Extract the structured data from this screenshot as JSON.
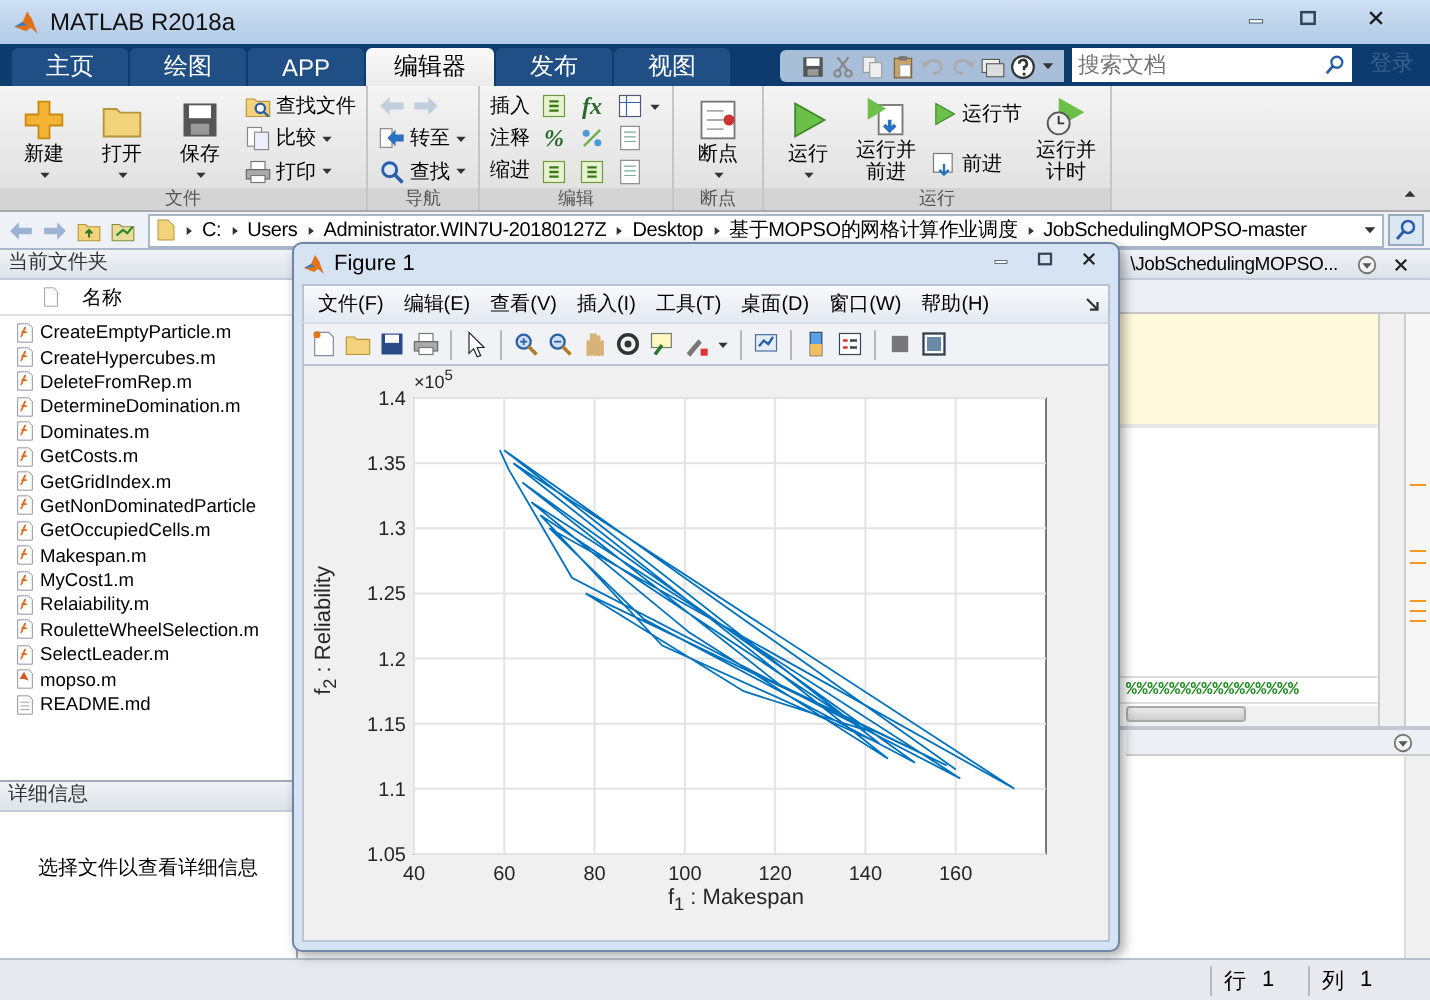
{
  "window": {
    "title": "MATLAB R2018a"
  },
  "tabs": [
    {
      "label": "主页",
      "selected": false
    },
    {
      "label": "绘图",
      "selected": false
    },
    {
      "label": "APP",
      "selected": false
    },
    {
      "label": "编辑器",
      "selected": true
    },
    {
      "label": "发布",
      "selected": false
    },
    {
      "label": "视图",
      "selected": false
    }
  ],
  "search": {
    "placeholder": "搜索文档"
  },
  "login": {
    "label": "登录",
    "disabled": true
  },
  "ribbon": {
    "groups": [
      {
        "title": "文件",
        "columns": [
          [
            {
              "kind": "large",
              "label": "新建",
              "menu": true
            }
          ],
          [
            {
              "kind": "large",
              "label": "打开",
              "menu": true
            }
          ],
          [
            {
              "kind": "large",
              "label": "保存",
              "menu": true
            }
          ],
          [
            {
              "kind": "small",
              "label": "查找文件",
              "menu": false
            },
            {
              "kind": "small",
              "label": "比较",
              "menu": true
            },
            {
              "kind": "small",
              "label": "打印",
              "menu": true
            }
          ]
        ]
      },
      {
        "title": "导航",
        "columns": [
          [
            {
              "kind": "arrows",
              "disabled": true
            },
            {
              "kind": "small",
              "label": "转至",
              "menu": true
            },
            {
              "kind": "small",
              "label": "查找",
              "menu": true
            }
          ]
        ]
      },
      {
        "title": "编辑",
        "columns": [
          [
            {
              "kind": "label",
              "label": "插入"
            },
            {
              "kind": "label",
              "label": "注释"
            },
            {
              "kind": "label",
              "label": "缩进"
            }
          ],
          [
            {
              "kind": "icon",
              "menu": false
            },
            {
              "kind": "glyph",
              "label": "%"
            },
            {
              "kind": "icon",
              "menu": false
            }
          ],
          [
            {
              "kind": "glyph",
              "label": "fx"
            },
            {
              "kind": "icon",
              "menu": false
            },
            {
              "kind": "icon",
              "menu": false
            }
          ],
          [
            {
              "kind": "icon",
              "menu": true
            },
            {
              "kind": "icon",
              "menu": false
            },
            {
              "kind": "icon",
              "menu": false
            }
          ]
        ]
      },
      {
        "title": "断点",
        "columns": [
          [
            {
              "kind": "large",
              "label": "断点",
              "menu": true
            }
          ]
        ]
      },
      {
        "title": "运行",
        "columns": [
          [
            {
              "kind": "large",
              "label": "运行",
              "menu": true
            }
          ],
          [
            {
              "kind": "large",
              "label": "运行并前进",
              "menu": false
            }
          ],
          [
            {
              "kind": "small",
              "label": "运行节",
              "menu": false
            },
            {
              "kind": "small",
              "label": "前进",
              "menu": false
            }
          ],
          [
            {
              "kind": "large",
              "label": "运行并计时",
              "menu": false
            }
          ]
        ]
      }
    ]
  },
  "path": [
    "C:",
    "Users",
    "Administrator.WIN7U-20180127Z",
    "Desktop",
    "基于MOPSO的网格计算作业调度",
    "JobSchedulingMOPSO-master"
  ],
  "current_folder": {
    "title": "当前文件夹",
    "column": "名称",
    "files": [
      {
        "name": "CreateEmptyParticle.m",
        "kind": "function"
      },
      {
        "name": "CreateHypercubes.m",
        "kind": "function"
      },
      {
        "name": "DeleteFromRep.m",
        "kind": "function"
      },
      {
        "name": "DetermineDomination.m",
        "kind": "function"
      },
      {
        "name": "Dominates.m",
        "kind": "function"
      },
      {
        "name": "GetCosts.m",
        "kind": "function"
      },
      {
        "name": "GetGridIndex.m",
        "kind": "function"
      },
      {
        "name": "GetNonDominatedParticle",
        "kind": "function"
      },
      {
        "name": "GetOccupiedCells.m",
        "kind": "function"
      },
      {
        "name": "Makespan.m",
        "kind": "function"
      },
      {
        "name": "MyCost1.m",
        "kind": "function"
      },
      {
        "name": "Relaiability.m",
        "kind": "function"
      },
      {
        "name": "RouletteWheelSelection.m",
        "kind": "function"
      },
      {
        "name": "SelectLeader.m",
        "kind": "function"
      },
      {
        "name": "mopso.m",
        "kind": "script"
      },
      {
        "name": "README.md",
        "kind": "text"
      }
    ]
  },
  "details": {
    "title": "详细信息",
    "hint": "选择文件以查看详细信息"
  },
  "editor": {
    "tab_title": "\\JobSchedulingMOPSO...",
    "code_line": "%%%%%%%%%%%%%%%%"
  },
  "status_bar": [
    {
      "label": "行",
      "value": "1"
    },
    {
      "label": "列",
      "value": "1"
    }
  ],
  "figure": {
    "title": "Figure 1",
    "menu": [
      "文件(F)",
      "编辑(E)",
      "查看(V)",
      "插入(I)",
      "工具(T)",
      "桌面(D)",
      "窗口(W)",
      "帮助(H)"
    ],
    "chart_data": {
      "type": "line",
      "xlabel": "f$_{1}$ : Makespan",
      "ylabel": "f$_{2}$ : Reliability",
      "x": [
        59,
        61,
        75,
        161,
        66,
        101,
        145,
        62,
        173,
        70,
        91,
        151,
        64,
        121,
        158,
        78,
        113,
        140,
        68,
        95,
        143,
        60,
        160
      ],
      "series": [
        {
          "color": "#0072bd",
          "values": [
            1.36,
            1.345,
            1.262,
            1.108,
            1.32,
            1.22,
            1.123,
            1.35,
            1.1,
            1.3,
            1.23,
            1.12,
            1.335,
            1.18,
            1.118,
            1.25,
            1.175,
            1.145,
            1.31,
            1.21,
            1.135,
            1.36,
            1.115
          ]
        }
      ],
      "xlim": [
        40,
        180
      ],
      "ylim": [
        1.05,
        1.4
      ],
      "grid": true,
      "xticks": [
        40,
        60,
        80,
        100,
        120,
        140,
        160
      ],
      "yticks": [
        1.05,
        1.1,
        1.15,
        1.2,
        1.25,
        1.3,
        1.35,
        1.4
      ],
      "annotations": [
        "×10$^{5}$"
      ]
    }
  }
}
